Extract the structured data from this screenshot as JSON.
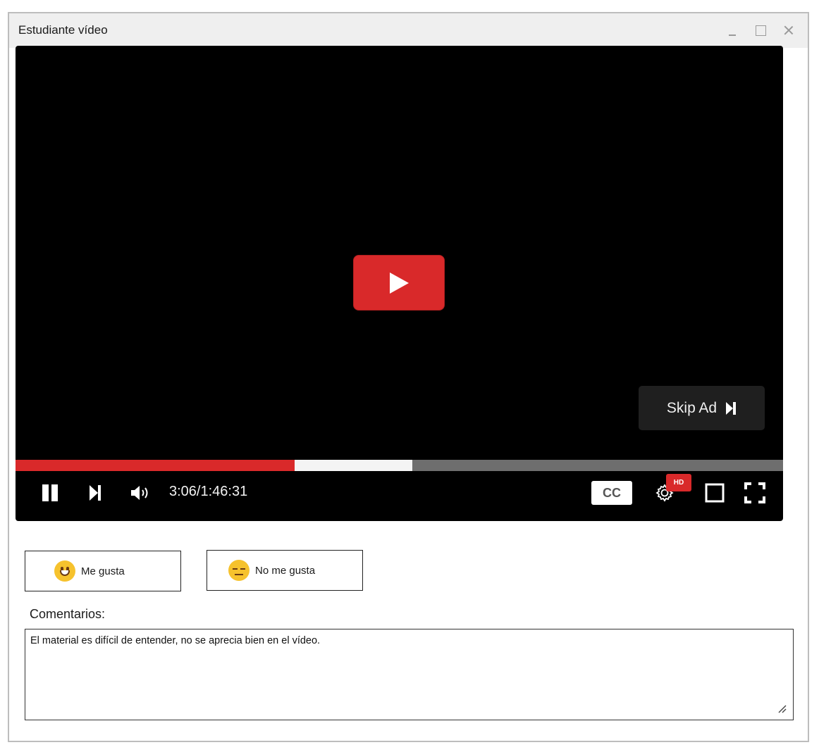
{
  "window": {
    "title": "Estudiante vídeo"
  },
  "player": {
    "time_display": "3:06/1:46:31",
    "progress": {
      "played": 0.364,
      "buffered": 0.517
    },
    "skip_ad_label": "Skip Ad",
    "cc_label": "CC",
    "hd_label": "HD",
    "accent_color": "#d9292a"
  },
  "reactions": {
    "like_label": "Me gusta",
    "dislike_label": "No me gusta"
  },
  "comments": {
    "label": "Comentarios:",
    "value": "El material es difícil de entender, no se aprecia bien en el vídeo."
  },
  "icons": {
    "window": [
      "minimize-icon",
      "maximize-icon",
      "close-icon"
    ],
    "player": [
      "play-icon",
      "pause-icon",
      "next-icon",
      "volume-icon",
      "settings-icon",
      "theater-mode-icon",
      "fullscreen-icon",
      "skip-icon"
    ],
    "reactions": [
      "smile-emoji-icon",
      "neutral-emoji-icon"
    ]
  }
}
